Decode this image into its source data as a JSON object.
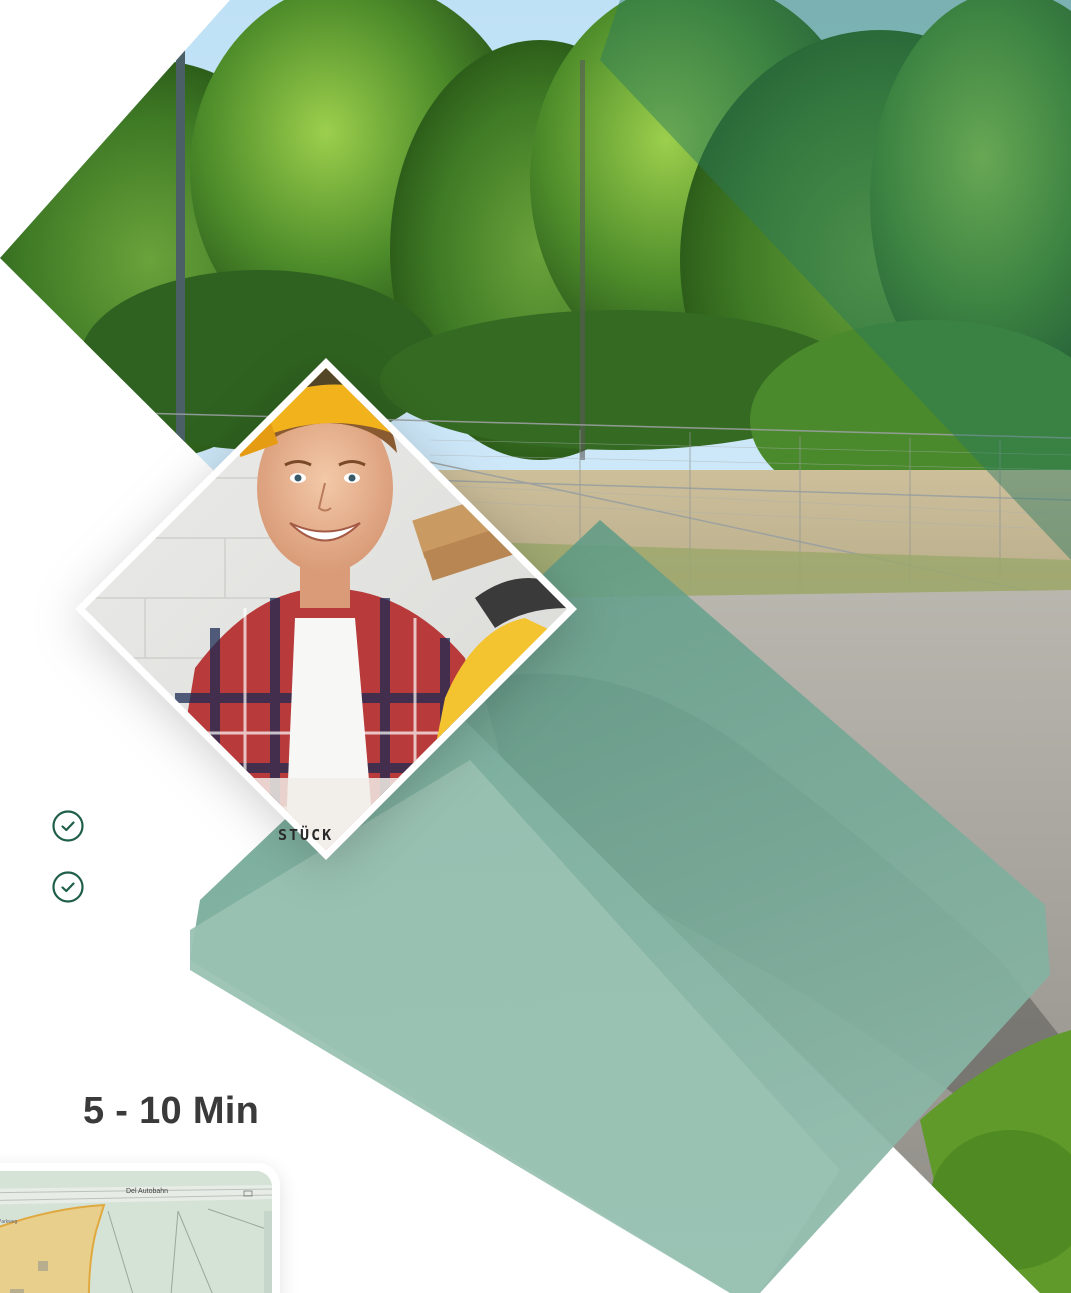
{
  "worker_caption": "STÜCK",
  "duration": "5 - 10 Min",
  "map": {
    "road_label": "Del Autobahn"
  },
  "icons": {
    "check_1": "check-circle-icon",
    "check_2": "check-circle-icon"
  },
  "colors": {
    "brand_teal": "#1f5e4a",
    "overlay_teal": "#3f8a72",
    "light_teal": "#9ac2b3"
  }
}
